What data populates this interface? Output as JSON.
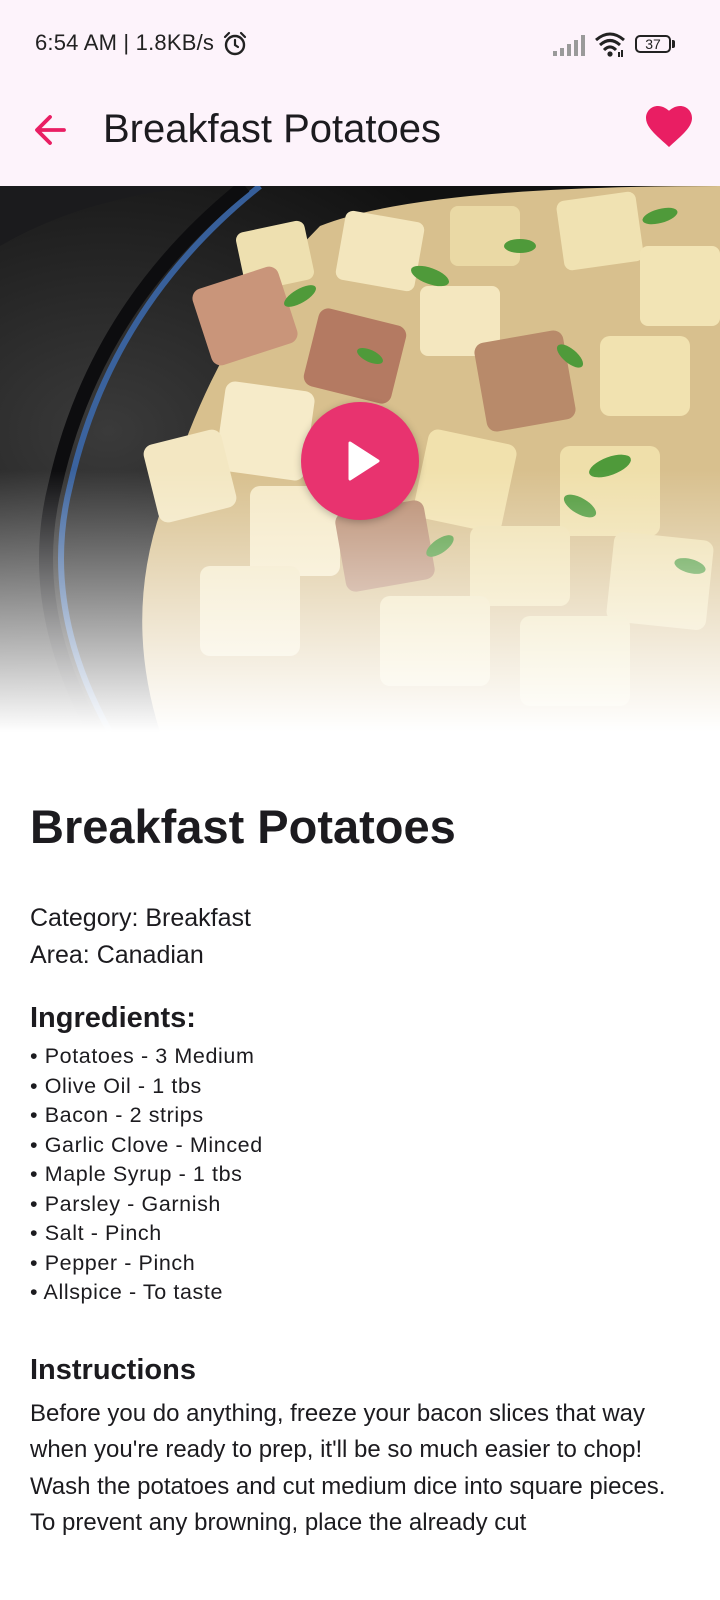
{
  "status_bar": {
    "time_speed": "6:54 AM | 1.8KB/s",
    "battery_level": "37",
    "icons": [
      "alarm-icon",
      "signal-icon",
      "wifi-icon",
      "battery-icon"
    ]
  },
  "app_bar": {
    "title": "Breakfast Potatoes",
    "back_icon": "arrow-left-icon",
    "favorite_icon": "heart-icon",
    "accent_color": "#e91e63",
    "background_color": "#fdf3fb"
  },
  "hero": {
    "play_icon": "play-icon",
    "play_button_color": "#e8336f"
  },
  "meal": {
    "title": "Breakfast Potatoes",
    "category": "Category: Breakfast",
    "area": "Area: Canadian"
  },
  "ingredients": {
    "heading": "Ingredients:",
    "items": [
      "• Potatoes - 3 Medium",
      "• Olive Oil - 1 tbs",
      "• Bacon - 2 strips",
      "• Garlic Clove - Minced",
      "• Maple Syrup - 1 tbs",
      "• Parsley - Garnish",
      "• Salt - Pinch",
      "• Pepper - Pinch",
      "• Allspice - To taste"
    ]
  },
  "instructions": {
    "heading": "Instructions",
    "paragraphs": [
      "Before you do anything, freeze your bacon slices that way when you're ready to prep, it'll be so much easier to chop!",
      "Wash the potatoes and cut medium dice into square pieces. To prevent any browning, place the already cut"
    ]
  }
}
